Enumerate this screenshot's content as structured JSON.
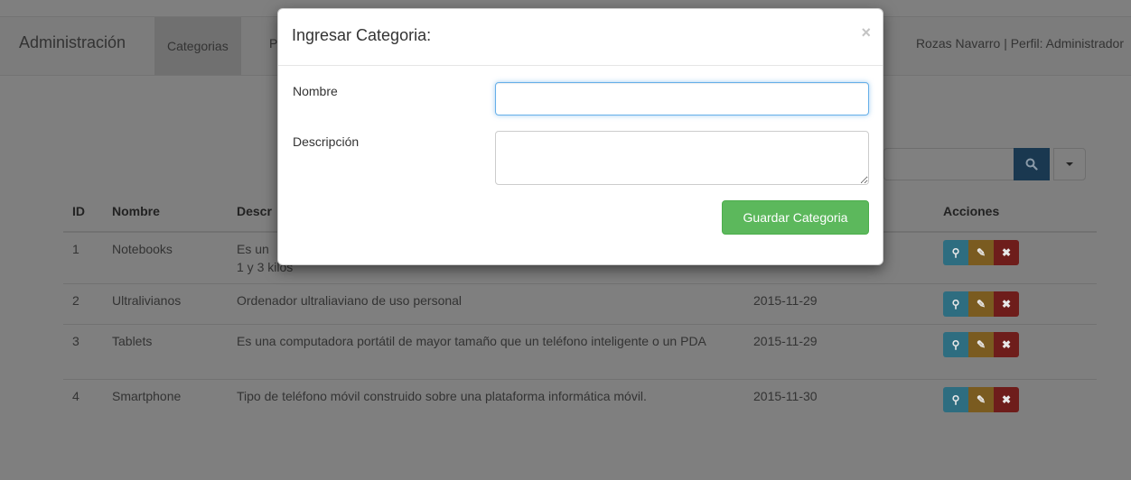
{
  "navbar": {
    "brand": "Administración",
    "items": [
      {
        "label": "Categorias"
      },
      {
        "label": "P"
      }
    ],
    "user_info": "Rozas Navarro | Perfil: Administrador"
  },
  "search": {
    "button_icon": "search-icon",
    "dropdown_icon": "caret-down-icon"
  },
  "table": {
    "headers": [
      "ID",
      "Nombre",
      "Descr",
      "",
      "Acciones"
    ],
    "rows": [
      {
        "id": "1",
        "nombre": "Notebooks",
        "descripcion": "Es un\n1 y 3 kilos",
        "fecha": ""
      },
      {
        "id": "2",
        "nombre": "Ultralivianos",
        "descripcion": "Ordenador ultraliaviano de uso personal",
        "fecha": "2015-11-29"
      },
      {
        "id": "3",
        "nombre": "Tablets",
        "descripcion": "Es una computadora portátil de mayor tamaño que un teléfono inteligente o un PDA",
        "fecha": "2015-11-29"
      },
      {
        "id": "4",
        "nombre": "Smartphone",
        "descripcion": "Tipo de teléfono móvil construido sobre una plataforma informática móvil.",
        "fecha": "2015-11-30"
      }
    ]
  },
  "modal": {
    "title": "Ingresar Categoria:",
    "close_symbol": "×",
    "nombre_label": "Nombre",
    "nombre_value": "",
    "descripcion_label": "Descripción",
    "descripcion_value": "",
    "save_label": "Guardar Categoria"
  },
  "colors": {
    "accent": "#66afe9",
    "success": "#5cb85c",
    "info": "#5bc0de",
    "warning": "#f0ad4e",
    "danger": "#d9534f",
    "primary": "#337ab7"
  }
}
